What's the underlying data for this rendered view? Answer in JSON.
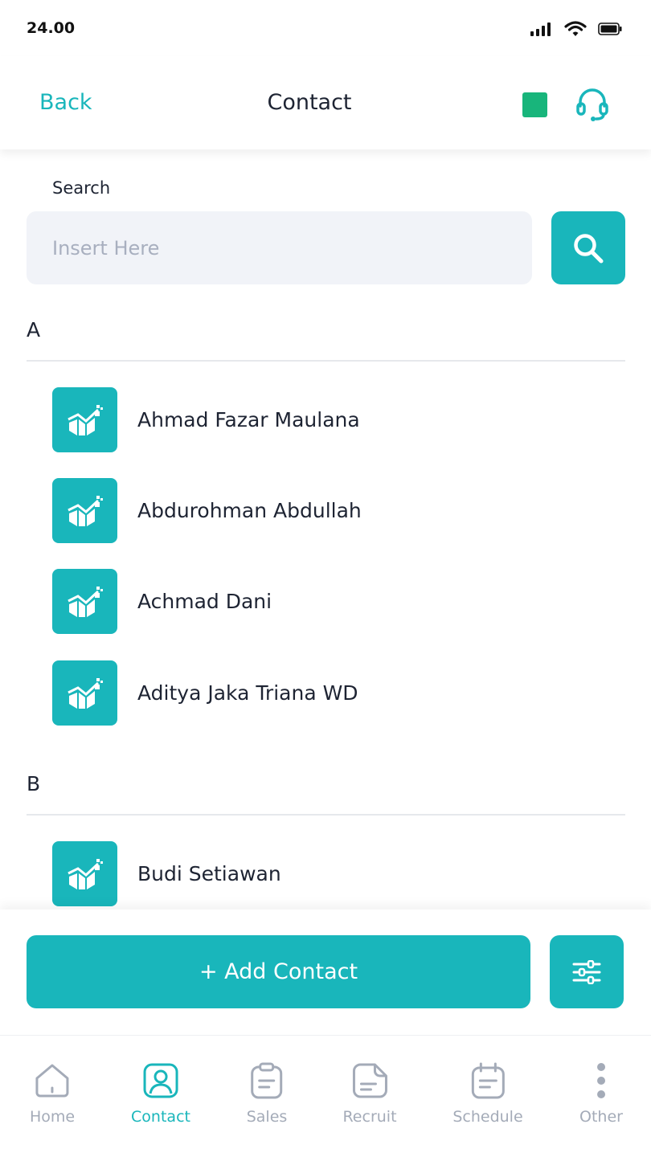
{
  "status_bar": {
    "time": "24.00"
  },
  "header": {
    "back_label": "Back",
    "title": "Contact"
  },
  "search": {
    "label": "Search",
    "placeholder": "Insert Here"
  },
  "contacts": {
    "sections": [
      {
        "letter": "A",
        "items": [
          {
            "name": "Ahmad Fazar Maulana"
          },
          {
            "name": "Abdurohman Abdullah"
          },
          {
            "name": "Achmad Dani"
          },
          {
            "name": "Aditya Jaka Triana WD"
          }
        ]
      },
      {
        "letter": "B",
        "items": [
          {
            "name": "Budi Setiawan"
          }
        ]
      }
    ]
  },
  "actions": {
    "add_label": "+ Add Contact"
  },
  "nav": {
    "items": [
      {
        "label": "Home",
        "icon": "home-icon",
        "active": false
      },
      {
        "label": "Contact",
        "icon": "contact-icon",
        "active": true
      },
      {
        "label": "Sales",
        "icon": "clipboard-icon",
        "active": false
      },
      {
        "label": "Recruit",
        "icon": "document-icon",
        "active": false
      },
      {
        "label": "Schedule",
        "icon": "calendar-icon",
        "active": false
      },
      {
        "label": "Other",
        "icon": "more-vertical-icon",
        "active": false
      }
    ]
  },
  "colors": {
    "accent": "#19b6bb",
    "status_green": "#18b57b",
    "text": "#1e2433",
    "muted": "#a4abb8",
    "input_bg": "#f1f3f8"
  }
}
